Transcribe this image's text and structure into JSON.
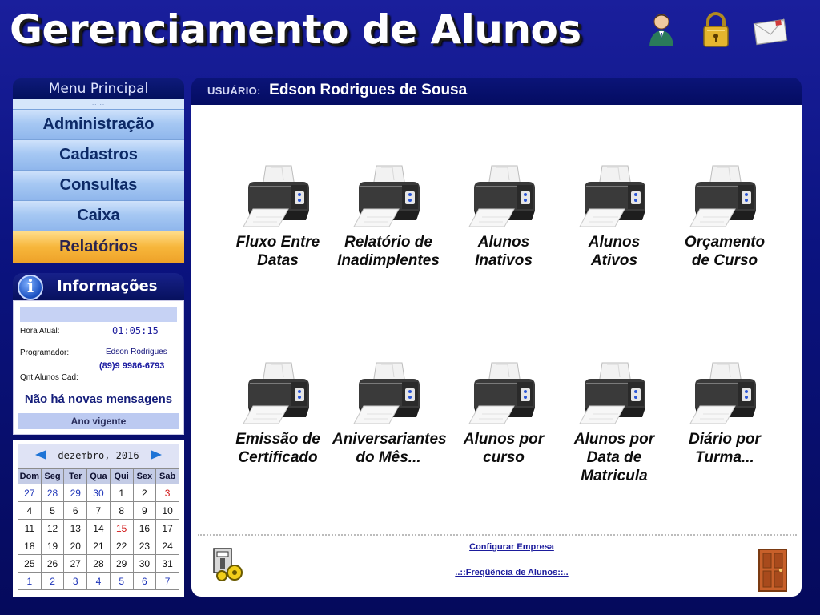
{
  "header": {
    "title": "Gerenciamento de Alunos",
    "icons": [
      "user-icon",
      "lock-icon",
      "mail-icon"
    ]
  },
  "menu": {
    "title": "Menu Principal",
    "grip": ".....",
    "items": [
      {
        "label": "Administração",
        "active": false
      },
      {
        "label": "Cadastros",
        "active": false
      },
      {
        "label": "Consultas",
        "active": false
      },
      {
        "label": "Caixa",
        "active": false
      },
      {
        "label": "Relatórios",
        "active": true
      }
    ]
  },
  "info": {
    "title": "Informações",
    "hora_label": "Hora Atual:",
    "hora_value": "01:05:15",
    "prog_label": "Programador:",
    "prog_name": "Edson Rodrigues",
    "prog_phone": "(89)9 9986-6793",
    "alunos_label": "Qnt Alunos Cad:",
    "no_messages": "Não há novas mensagens",
    "ano": "Ano vigente"
  },
  "calendar": {
    "month": "dezembro, 2016",
    "days": [
      "Dom",
      "Seg",
      "Ter",
      "Qua",
      "Qui",
      "Sex",
      "Sab"
    ],
    "weeks": [
      [
        "27",
        "28",
        "29",
        "30",
        "1",
        "2",
        "3"
      ],
      [
        "4",
        "5",
        "6",
        "7",
        "8",
        "9",
        "10"
      ],
      [
        "11",
        "12",
        "13",
        "14",
        "15",
        "16",
        "17"
      ],
      [
        "18",
        "19",
        "20",
        "21",
        "22",
        "23",
        "24"
      ],
      [
        "25",
        "26",
        "27",
        "28",
        "29",
        "30",
        "31"
      ],
      [
        "1",
        "2",
        "3",
        "4",
        "5",
        "6",
        "7"
      ]
    ]
  },
  "user": {
    "label": "USUÁRIO:",
    "name": "Edson Rodrigues de Sousa"
  },
  "reports": [
    {
      "line1": "Fluxo Entre",
      "line2": "Datas",
      "line3": ""
    },
    {
      "line1": "Relatório de",
      "line2": "Inadimplentes",
      "line3": ""
    },
    {
      "line1": "Alunos",
      "line2": "Inativos",
      "line3": ""
    },
    {
      "line1": "Alunos",
      "line2": "Ativos",
      "line3": ""
    },
    {
      "line1": "Orçamento",
      "line2": "de Curso",
      "line3": ""
    },
    {
      "line1": "Emissão de",
      "line2": "Certificado",
      "line3": ""
    },
    {
      "line1": "Aniversariantes",
      "line2": "do Mês...",
      "line3": ""
    },
    {
      "line1": "Alunos por",
      "line2": "curso",
      "line3": ""
    },
    {
      "line1": "Alunos por",
      "line2": "Data de",
      "line3": "Matricula"
    },
    {
      "line1": "Diário por",
      "line2": "Turma...",
      "line3": ""
    }
  ],
  "footer": {
    "config_link": "Configurar Empresa",
    "freq_link": "..::Freqüência de Alunos::.."
  }
}
